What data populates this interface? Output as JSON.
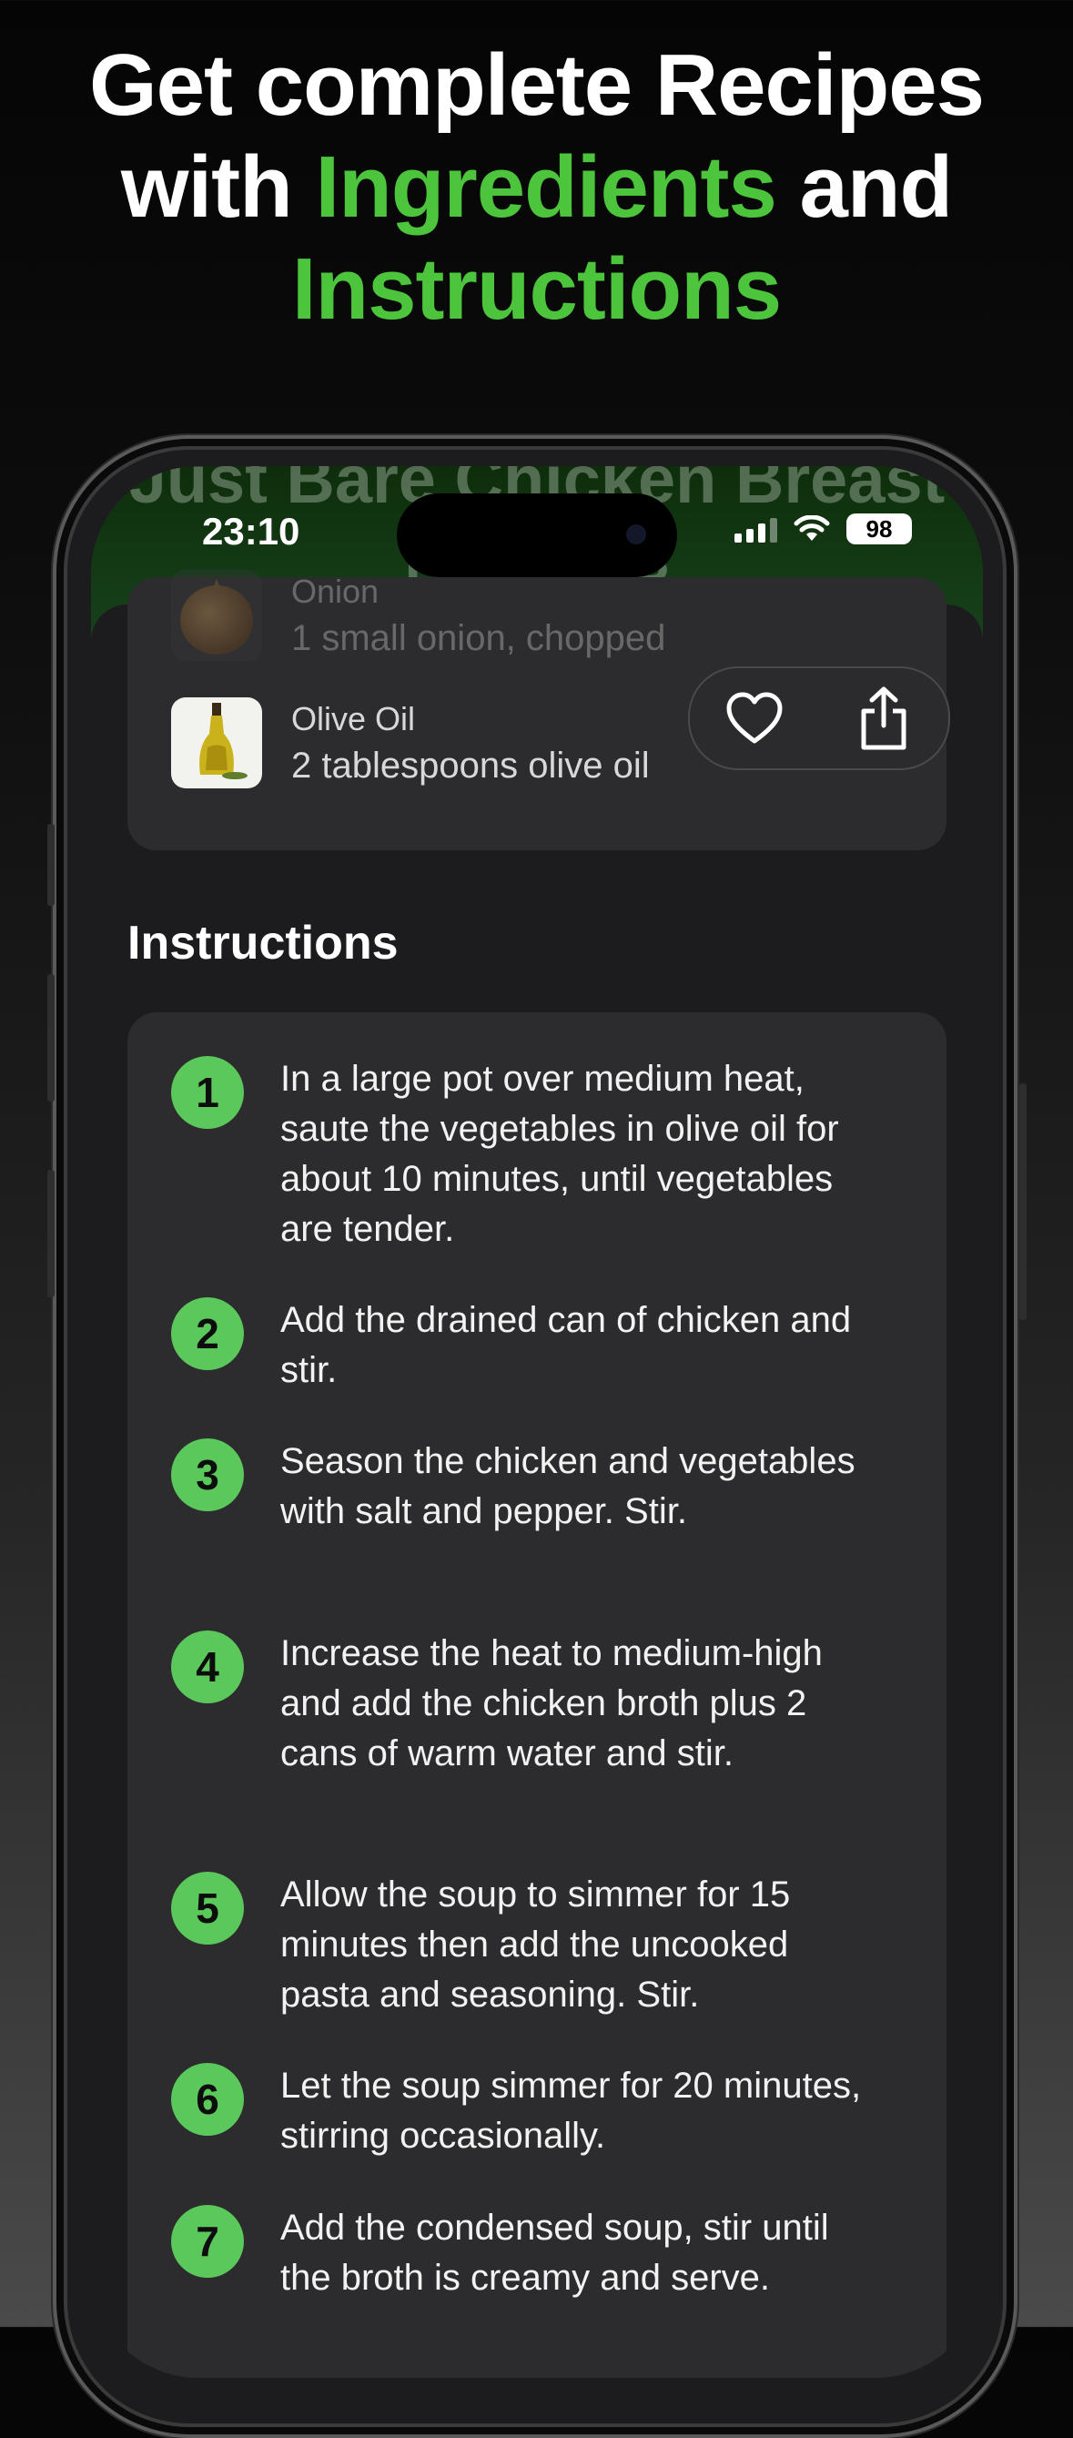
{
  "headline": {
    "line1": "Get complete Recipes",
    "line2_prefix": "with",
    "line2_highlight": "Ingredients",
    "line2_suffix": "and",
    "line3_highlight": "Instructions"
  },
  "hero": {
    "recipe_title": "Just Bare Chicken Breast Noodles"
  },
  "status_bar": {
    "time": "23:10",
    "battery": "98"
  },
  "ingredients": [
    {
      "name": "Onion",
      "description": "1 small onion, chopped",
      "icon": "onion-image"
    },
    {
      "name": "Olive Oil",
      "description": "2 tablespoons olive oil",
      "icon": "olive-oil-image"
    }
  ],
  "actions": {
    "favorite_icon": "heart-icon",
    "share_icon": "share-icon"
  },
  "instructions": {
    "title": "Instructions",
    "steps": [
      {
        "number": "1",
        "text": "In a large pot over medium heat, saute the vegetables in olive oil for about 10 minutes, until vegetables are tender."
      },
      {
        "number": "2",
        "text": "Add the drained can of chicken and stir."
      },
      {
        "number": "3",
        "text": "Season the chicken and vegetables with salt and pepper. Stir."
      },
      {
        "number": "4",
        "text": "Increase the heat to medium-high and add the chicken broth plus 2 cans of warm water and stir."
      },
      {
        "number": "5",
        "text": "Allow the soup to simmer for 15 minutes then add the uncooked pasta and seasoning. Stir."
      },
      {
        "number": "6",
        "text": "Let the soup simmer for 20 minutes, stirring occasionally."
      },
      {
        "number": "7",
        "text": "Add the condensed soup, stir until the broth is creamy and serve."
      }
    ]
  },
  "colors": {
    "accent_green": "#4cc53d",
    "step_badge": "#5ac85a",
    "card": "#2c2c2e"
  }
}
